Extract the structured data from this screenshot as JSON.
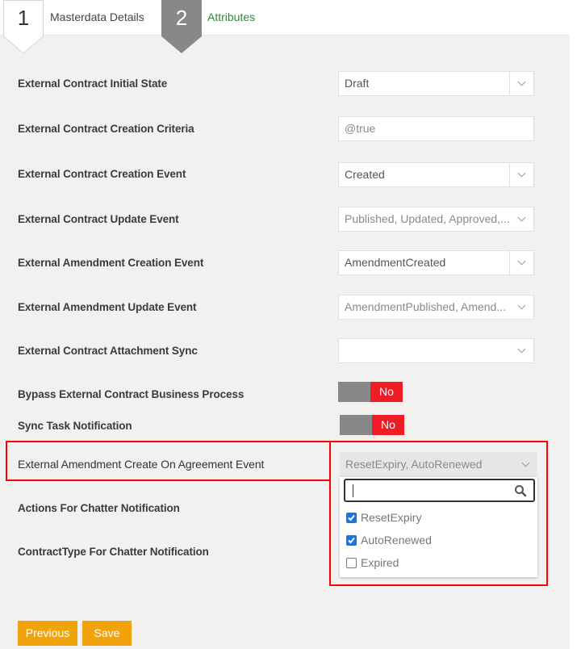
{
  "wizard": {
    "steps": [
      {
        "number": "1",
        "label": "Masterdata Details",
        "active": false
      },
      {
        "number": "2",
        "label": "Attributes",
        "active": true
      }
    ]
  },
  "form": {
    "rows": [
      {
        "label": "External Contract Initial State",
        "type": "select",
        "value": "Draft"
      },
      {
        "label": "External Contract Creation Criteria",
        "type": "text",
        "value": "@true"
      },
      {
        "label": "External Contract Creation Event",
        "type": "select",
        "value": "Created"
      },
      {
        "label": "External Contract Update Event",
        "type": "multiselect",
        "value": "Published, Updated, Approved,..."
      },
      {
        "label": "External Amendment Creation Event",
        "type": "select",
        "value": "AmendmentCreated"
      },
      {
        "label": "External Amendment Update Event",
        "type": "multiselect",
        "value": "AmendmentPublished, Amend..."
      },
      {
        "label": "External Contract Attachment Sync",
        "type": "multiselect",
        "value": ""
      },
      {
        "label": "Bypass External Contract Business Process",
        "type": "toggle",
        "value": "No"
      },
      {
        "label": "Sync Task Notification",
        "type": "toggle",
        "value": "No"
      },
      {
        "label": "External Amendment Create On Agreement Event",
        "type": "multiselect-open",
        "value": "ResetExpiry, AutoRenewed"
      },
      {
        "label": "Actions For Chatter Notification",
        "type": "none"
      },
      {
        "label": "ContractType For Chatter Notification",
        "type": "none"
      }
    ],
    "open_dropdown": {
      "search_value": "",
      "options": [
        {
          "label": "ResetExpiry",
          "checked": true
        },
        {
          "label": "AutoRenewed",
          "checked": true
        },
        {
          "label": "Expired",
          "checked": false
        }
      ]
    }
  },
  "actions": {
    "previous_label": "Previous",
    "save_label": "Save"
  },
  "colors": {
    "accent_green": "#2e8b3c",
    "toggle_no": "#ee1c25",
    "button": "#f0a30a",
    "highlight": "#ff0000",
    "checkbox": "#1a73e8"
  }
}
